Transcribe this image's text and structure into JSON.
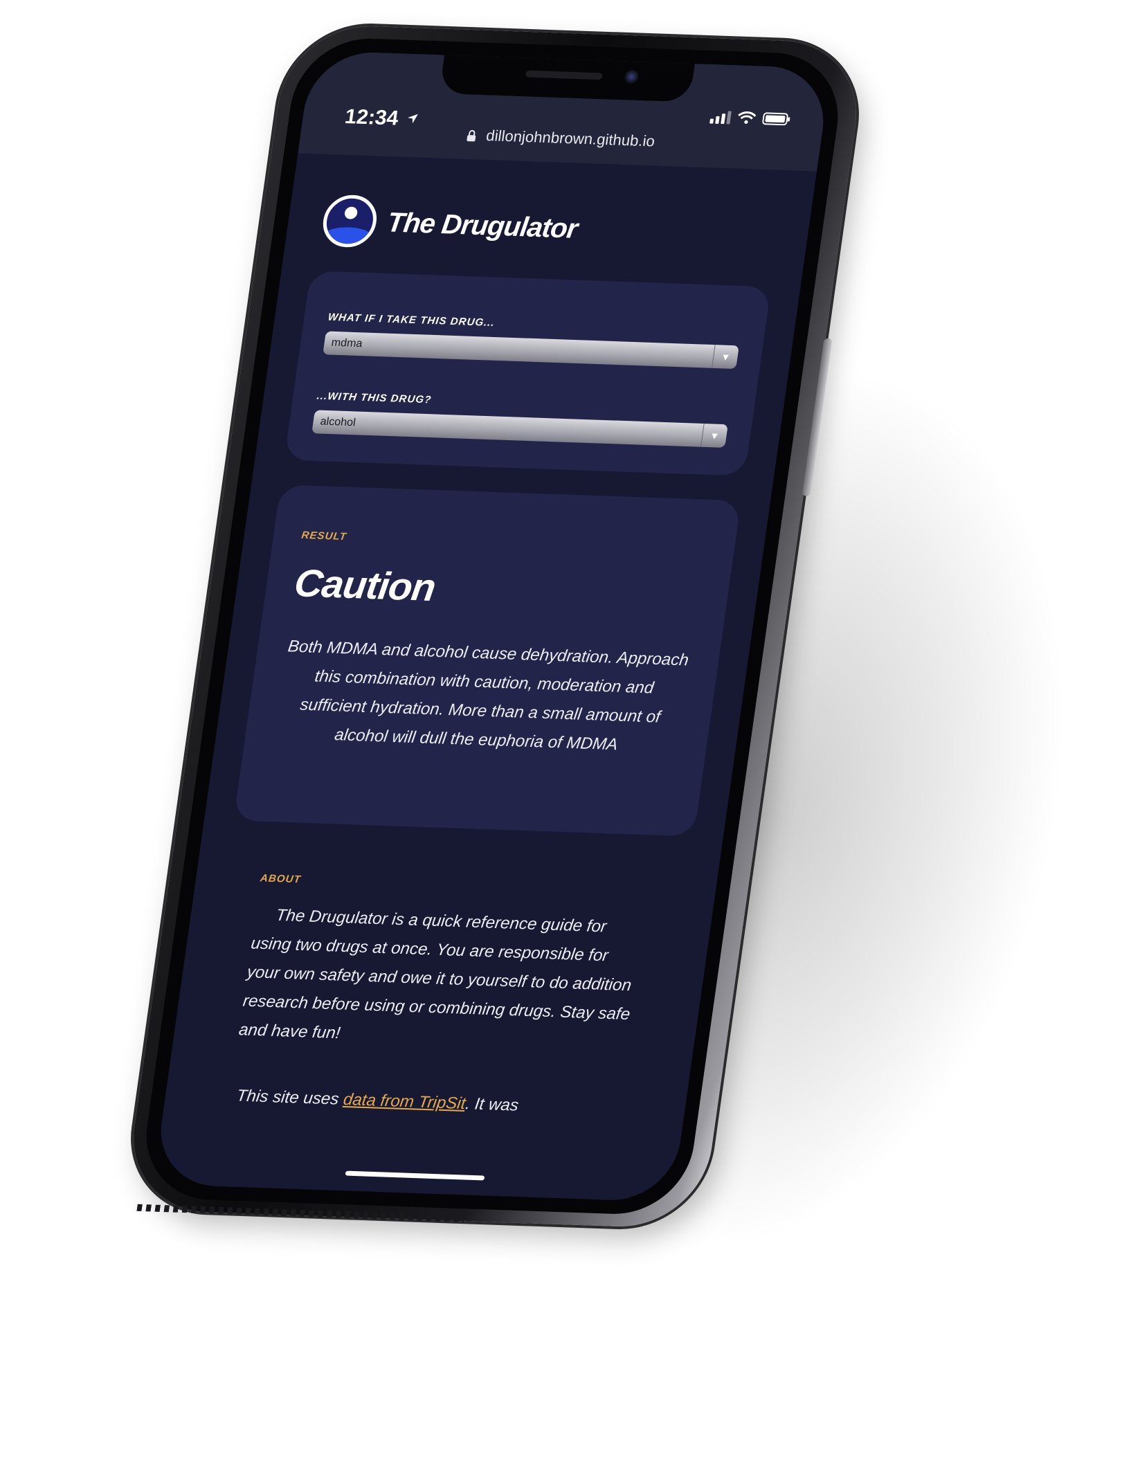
{
  "status_bar": {
    "time": "12:34",
    "url": "dillonjohnbrown.github.io"
  },
  "brand": {
    "title": "The Drugulator"
  },
  "form": {
    "drug1_label": "WHAT IF I TAKE THIS DRUG...",
    "drug1_value": "mdma",
    "drug2_label": "...WITH THIS DRUG?",
    "drug2_value": "alcohol"
  },
  "result": {
    "eyebrow": "RESULT",
    "title": "Caution",
    "body": "Both MDMA and alcohol cause dehydration. Approach this combination with caution, moderation and sufficient hydration. More than a small amount of alcohol will dull the euphoria of MDMA"
  },
  "about": {
    "eyebrow": "ABOUT",
    "body": "The Drugulator is a quick reference guide for using two drugs at once. You are responsible for your own safety and owe it to yourself to do addition research before using or combining drugs. Stay safe and have fun!"
  },
  "footer": {
    "prefix": "This site uses ",
    "link": "data from TripSit",
    "suffix": ". It was"
  },
  "colors": {
    "background": "#171933",
    "card": "#23244a",
    "accent": "#e4a94b",
    "logo_blue": "#2a52e8"
  },
  "icons": [
    "lock-icon",
    "location-icon",
    "signal-icon",
    "wifi-icon",
    "battery-icon",
    "chevron-down-icon",
    "logo-icon"
  ]
}
